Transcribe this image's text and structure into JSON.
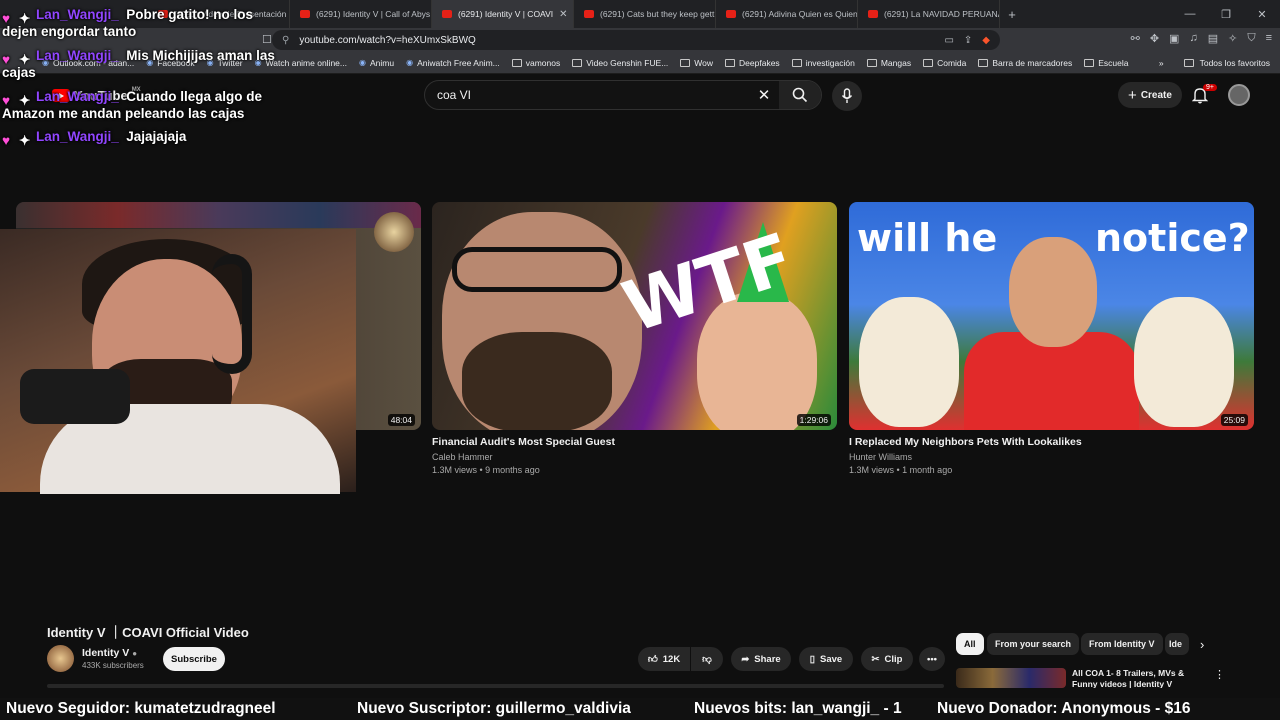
{
  "browser": {
    "tabs": [
      {
        "label": "(6291) Video de Presentación |"
      },
      {
        "label": "(6291) Identity V | Call of Abys"
      },
      {
        "label": "(6291) Identity V | COAVI",
        "active": true
      },
      {
        "label": "(6291) Cats but they keep gett"
      },
      {
        "label": "(6291) Adivina Quien es Quien"
      },
      {
        "label": "(6291) La NAVIDAD PERUANA"
      }
    ],
    "url_main": "youtube.com/watch?v=heXUmxSkBWQ",
    "bookmarks": [
      {
        "label": "Outlook.com - adan...",
        "icon": "outlook-icon"
      },
      {
        "label": "Facebook",
        "icon": "facebook-icon"
      },
      {
        "label": "Twitter",
        "icon": "twitter-icon"
      },
      {
        "label": "Watch anime online...",
        "icon": "anime-icon"
      },
      {
        "label": "Animu",
        "icon": "globe-icon"
      },
      {
        "label": "Aniwatch Free Anim...",
        "icon": "globe-icon"
      },
      {
        "label": "vamonos",
        "icon": "folder-icon"
      },
      {
        "label": "Video Genshin FUE...",
        "icon": "folder-icon"
      },
      {
        "label": "Wow",
        "icon": "folder-icon"
      },
      {
        "label": "Deepfakes",
        "icon": "folder-icon"
      },
      {
        "label": "investigación",
        "icon": "folder-icon"
      },
      {
        "label": "Mangas",
        "icon": "folder-icon"
      },
      {
        "label": "Comida",
        "icon": "folder-icon"
      },
      {
        "label": "Barra de marcadores",
        "icon": "folder-icon"
      },
      {
        "label": "Escuela",
        "icon": "folder-icon"
      }
    ],
    "all_bookmarks": "Todos los favoritos"
  },
  "youtube": {
    "logo": "YouTube",
    "region": "MX",
    "search_value": "coa VI",
    "create_label": "Create",
    "notif_count": "9+"
  },
  "videos": [
    {
      "title": "",
      "channel": "",
      "meta": "",
      "duration": "48:04"
    },
    {
      "title": "Financial Audit's Most Special Guest",
      "channel": "Caleb Hammer",
      "meta": "1.3M views • 9 months ago",
      "duration": "1:29:06",
      "overlay": "WTF"
    },
    {
      "title": "I Replaced My Neighbors Pets With Lookalikes",
      "channel": "Hunter Williams",
      "meta": "1.3M views • 1 month ago",
      "duration": "25:09",
      "overlay_left": "will he",
      "overlay_right": "notice?"
    }
  ],
  "current_video": {
    "title": "Identity V ｜COAVI Official Video",
    "channel": "Identity V",
    "subscribers": "433K subscribers",
    "subscribe_label": "Subscribe",
    "likes": "12K",
    "share_label": "Share",
    "save_label": "Save",
    "clip_label": "Clip"
  },
  "chips": [
    "All",
    "From your search",
    "From Identity V",
    "Ide"
  ],
  "sidebar_next": {
    "title": "All COA 1- 8 Trailers, MVs & Funny videos | Identity V"
  },
  "chat": [
    {
      "user": "Lan_Wangji_",
      "line1": "Pobre gatito! no los",
      "line2": "dejen engordar tanto"
    },
    {
      "user": "Lan_Wangji_",
      "line1": "Mis Michijijas aman las",
      "line2": "cajas"
    },
    {
      "user": "Lan_Wangji_",
      "line1": "Cuando llega algo de",
      "line2": "Amazon me andan peleando las cajas"
    },
    {
      "user": "Lan_Wangji_",
      "line1": "Jajajajaja",
      "line2": ""
    }
  ],
  "ticker": [
    "Nuevo Seguidor: kumatetzudragneel",
    "Nuevo Suscriptor: guillermo_valdivia",
    "Nuevos bits: lan_wangji_ - 1",
    "Nuevo Donador: Anonymous - $16"
  ],
  "colors": {
    "youtube_red": "#ff0000",
    "chat_user": "#9146ff",
    "heart": "#ff4fd8",
    "bg": "#0f0f0f"
  }
}
